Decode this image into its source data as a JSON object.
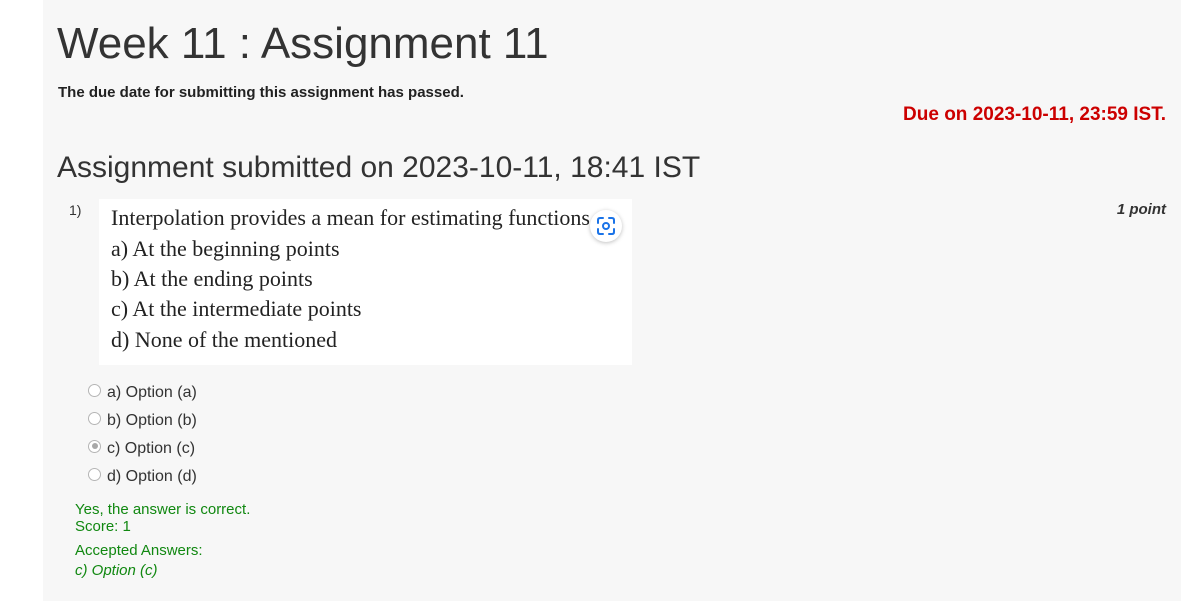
{
  "assignment": {
    "title": "Week 11 : Assignment 11",
    "due_passed_notice": "The due date for submitting this assignment has passed.",
    "due_text": "Due on 2023-10-11, 23:59 IST.",
    "submitted_text": "Assignment submitted on 2023-10-11, 18:41 IST"
  },
  "question": {
    "number": "1)",
    "points": "1 point",
    "image_lines": [
      "Interpolation provides a mean for estimating functions",
      "a) At the beginning points",
      "b) At the ending points",
      "c) At the intermediate points",
      "d) None of the mentioned"
    ],
    "options": [
      {
        "label": "a) Option (a)",
        "selected": false
      },
      {
        "label": "b) Option (b)",
        "selected": false
      },
      {
        "label": "c) Option (c)",
        "selected": true
      },
      {
        "label": "d) Option (d)",
        "selected": false
      }
    ],
    "feedback": {
      "result": "Yes, the answer is correct.",
      "score": "Score: 1",
      "accepted_label": "Accepted Answers:",
      "accepted_answer": "c) Option (c)"
    }
  },
  "icons": {
    "lens_icon": "google-lens-icon"
  },
  "colors": {
    "due": "#cc0000",
    "feedback": "#118811",
    "panel_background": "#f7f7f7"
  }
}
